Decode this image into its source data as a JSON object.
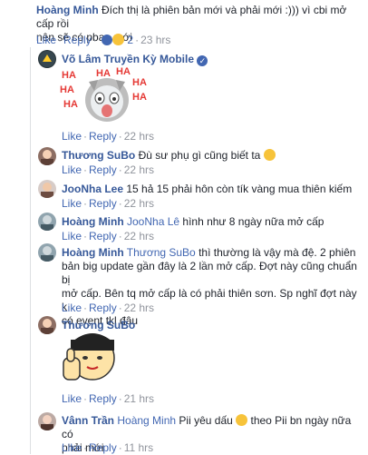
{
  "comments": [
    {
      "name": "Hoàng Minh",
      "text_line1": "Đích thị là phiên bản mới và phải mới :))) vì cbi mở cấp rồi",
      "text_line2": "nên sẽ có pban mới",
      "reaction_count": "2",
      "time": "23 hrs"
    },
    {
      "name": "Võ Lâm Truyền Kỳ Mobile",
      "sticker_text": "HA HA HA HA HA HA HA",
      "time": "22 hrs"
    },
    {
      "name": "Thương SuBo",
      "text": "Đù sư phụ gì cũng biết ta",
      "time": "22 hrs"
    },
    {
      "name": "JooNha Lee",
      "text": "15 hả 15 phải hôn còn tík vàng mua thiên kiếm",
      "time": "22 hrs"
    },
    {
      "name": "Hoàng Minh",
      "tag": "JooNha Lê",
      "text": "hình như 8 ngày nữa mở cấp",
      "time": "22 hrs"
    },
    {
      "name": "Hoàng Minh",
      "tag": "Thương SuBo",
      "text_line1": "thì thường là vậy mà đệ. 2 phiên",
      "text_line2": "bản big update gần đây là 2 lần mở cấp. Đợt này cũng chuẩn bị",
      "text_line3": "mở cấp. Bên tq mở cấp là có phải thiên sơn. Sp nghĩ đợt này k",
      "text_line4": "có event tkl đâu",
      "time": "22 hrs"
    },
    {
      "name": "Thương SuBo",
      "time": "21 hrs"
    },
    {
      "name": "Vânn Trần",
      "tag": "Hoàng Minh",
      "text_line1": "Pii yêu dấu",
      "text_line1b": "theo Pii bn ngày nữa có",
      "text_line2": "phải mới",
      "time": "11 hrs"
    }
  ],
  "actions": {
    "like": "Like",
    "reply": "Reply",
    "sep": "·"
  },
  "colors": {
    "link": "#4267b2",
    "name": "#365899",
    "meta": "#90949c"
  }
}
